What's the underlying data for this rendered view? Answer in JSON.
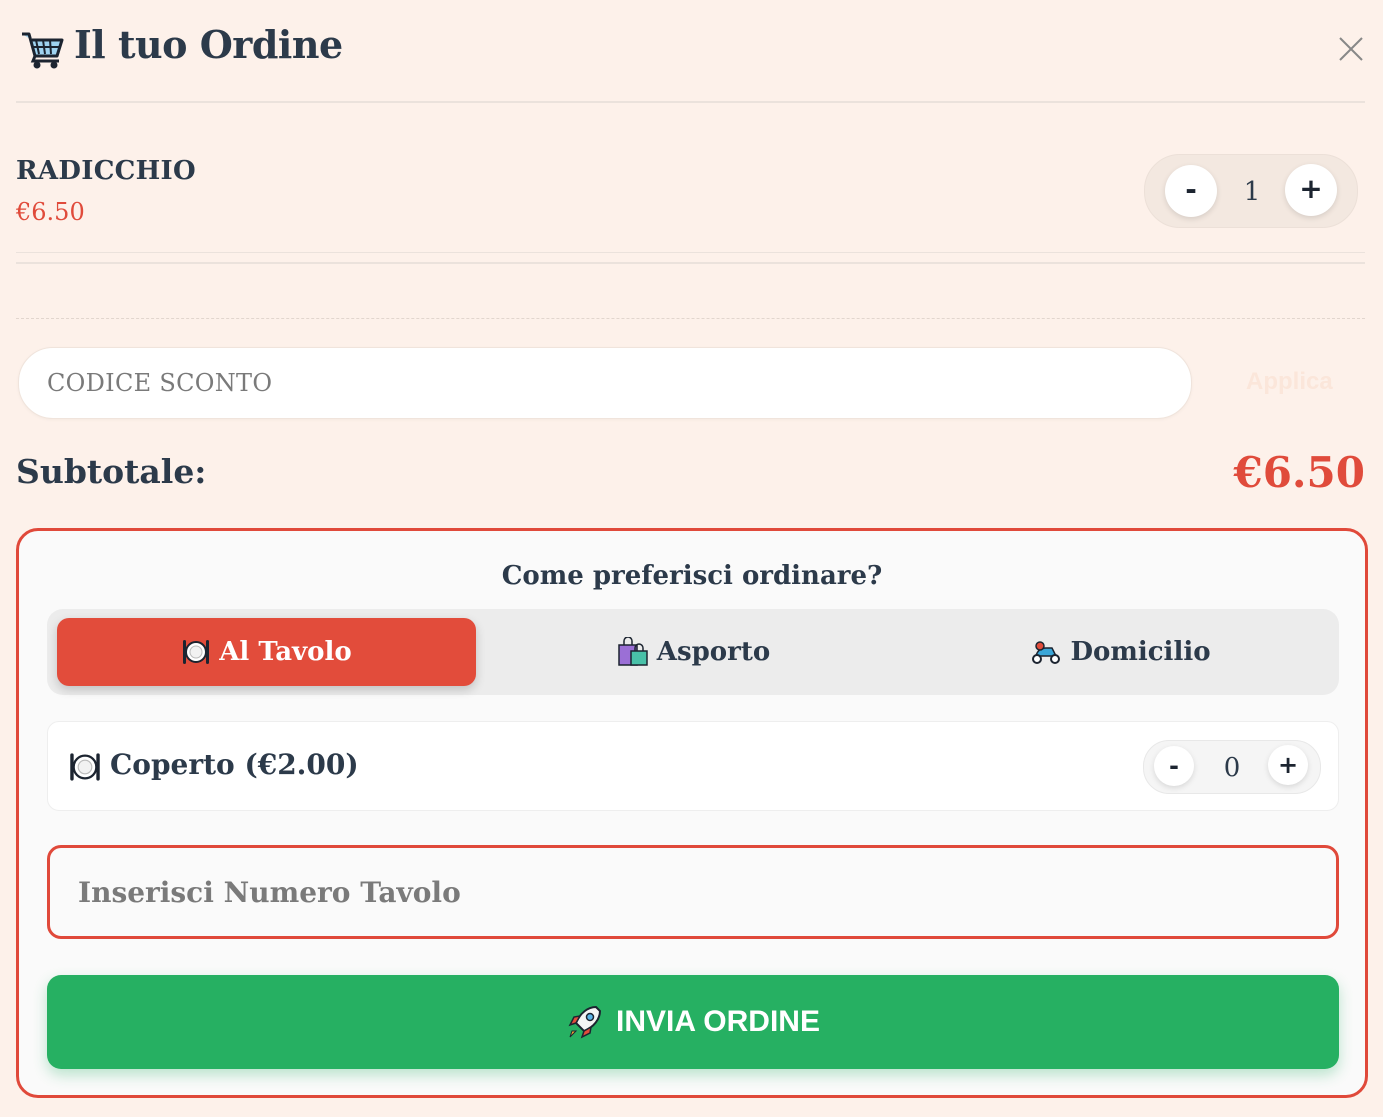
{
  "header": {
    "title": "Il tuo Ordine",
    "icon": "shopping-cart-icon",
    "close_icon": "close-icon"
  },
  "cart": {
    "items": [
      {
        "name": "RADICCHIO",
        "price": "€6.50",
        "quantity": "1",
        "minus": "-",
        "plus": "+"
      }
    ]
  },
  "coupon": {
    "placeholder": "CODICE SCONTO",
    "apply_label": "Applica"
  },
  "subtotal": {
    "label": "Subtotale:",
    "value": "€6.50"
  },
  "order_type": {
    "title": "Come preferisci ordinare?",
    "options": [
      {
        "label": "Al Tavolo",
        "icon": "plate-cutlery-icon",
        "active": true
      },
      {
        "label": "Asporto",
        "icon": "shopping-bag-icon",
        "active": false
      },
      {
        "label": "Domicilio",
        "icon": "scooter-icon",
        "active": false
      }
    ]
  },
  "coperto": {
    "label": "Coperto (€2.00)",
    "quantity": "0",
    "minus": "-",
    "plus": "+"
  },
  "table_number": {
    "placeholder": "Inserisci Numero Tavolo"
  },
  "submit": {
    "label": "INVIA ORDINE",
    "icon": "rocket-icon"
  },
  "colors": {
    "accent": "#e24c3b",
    "success": "#26b062",
    "background": "#fdf1ea",
    "text": "#2c3a4a"
  }
}
